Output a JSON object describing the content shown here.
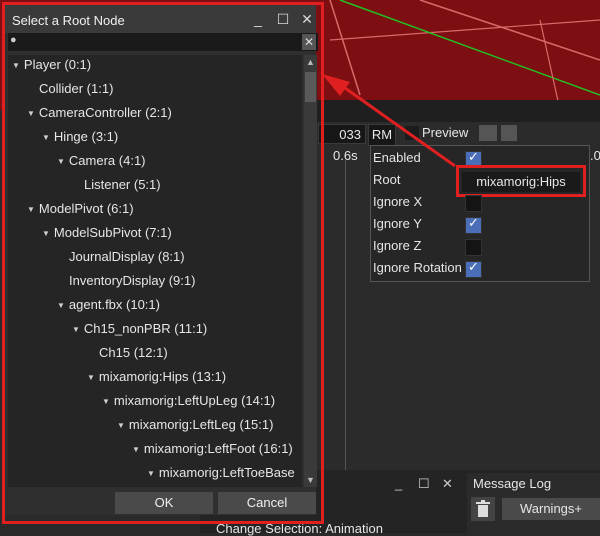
{
  "dialog": {
    "title": "Select a Root Node",
    "ok_label": "OK",
    "cancel_label": "Cancel",
    "search": {
      "value": ""
    },
    "tree": [
      {
        "label": "Player (0:1)",
        "expanded": true
      },
      {
        "label": "Collider (1:1)",
        "expanded": false
      },
      {
        "label": "CameraController (2:1)",
        "expanded": true
      },
      {
        "label": "Hinge (3:1)",
        "expanded": true
      },
      {
        "label": "Camera (4:1)",
        "expanded": true
      },
      {
        "label": "Listener (5:1)",
        "expanded": false
      },
      {
        "label": "ModelPivot (6:1)",
        "expanded": true
      },
      {
        "label": "ModelSubPivot (7:1)",
        "expanded": true
      },
      {
        "label": "JournalDisplay (8:1)",
        "expanded": false
      },
      {
        "label": "InventoryDisplay (9:1)",
        "expanded": false
      },
      {
        "label": "agent.fbx (10:1)",
        "expanded": true
      },
      {
        "label": "Ch15_nonPBR (11:1)",
        "expanded": true
      },
      {
        "label": "Ch15 (12:1)",
        "expanded": false
      },
      {
        "label": "mixamorig:Hips (13:1)",
        "expanded": true
      },
      {
        "label": "mixamorig:LeftUpLeg (14:1)",
        "expanded": true
      },
      {
        "label": "mixamorig:LeftLeg (15:1)",
        "expanded": true
      },
      {
        "label": "mixamorig:LeftFoot (16:1)",
        "expanded": true
      },
      {
        "label": "mixamorig:LeftToeBase",
        "expanded": true
      }
    ]
  },
  "animation_toolbar": {
    "frame_value": "033",
    "rm_label": "RM",
    "preview_label": "Preview",
    "time_label": "0.6s",
    "right_edge_value": ".0"
  },
  "properties": {
    "enabled_label": "Enabled",
    "enabled": true,
    "root_label": "Root",
    "root_value": "mixamorig:Hips",
    "ignore_x_label": "Ignore X",
    "ignore_x": false,
    "ignore_y_label": "Ignore Y",
    "ignore_y": true,
    "ignore_z_label": "Ignore Z",
    "ignore_z": false,
    "ignore_rotation_label": "Ignore Rotation",
    "ignore_rotation": true
  },
  "message_log": {
    "title": "Message Log",
    "warnings_label": "Warnings+"
  },
  "command_panel": {
    "change_selection": "Change Selection: Animation"
  },
  "colors": {
    "highlight": "#e02020",
    "checkbox_on": "#4a6fb8"
  }
}
